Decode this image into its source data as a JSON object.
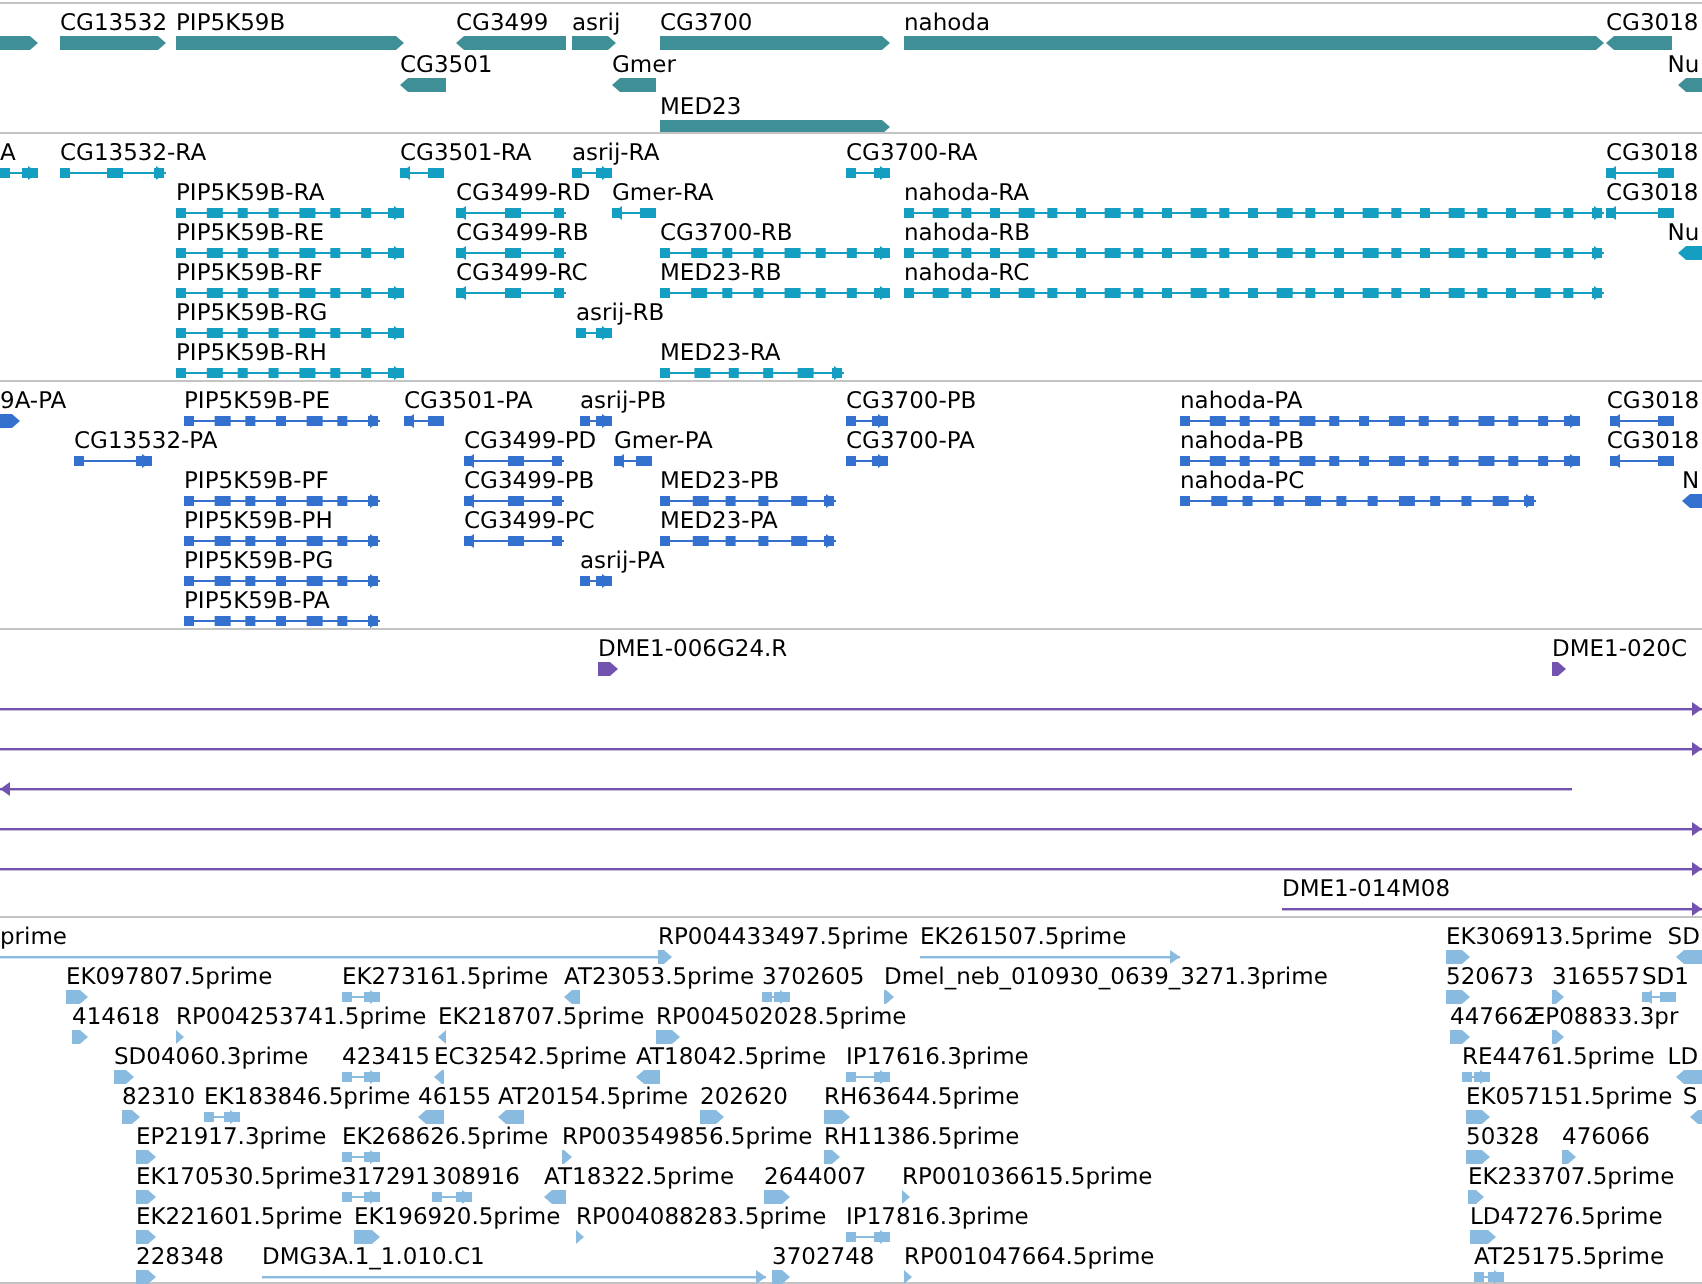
{
  "tracks": [
    {
      "color": "#3f9096",
      "features": [
        {
          "kind": "bar",
          "reverse": false
        },
        {
          "label": "CG13532",
          "kind": "bar",
          "reverse": false
        },
        {
          "label": "PIP5K59B",
          "kind": "bar",
          "reverse": false
        },
        {
          "label": "CG3499",
          "kind": "bar",
          "reverse": true
        },
        {
          "label": "asrij",
          "kind": "bar",
          "reverse": false
        },
        {
          "label": "CG3700",
          "kind": "bar",
          "reverse": false
        },
        {
          "label": "nahoda",
          "kind": "bar",
          "reverse": false
        },
        {
          "label": "CG3018",
          "kind": "bar",
          "reverse": true
        },
        {
          "label": "CG3501",
          "kind": "bar",
          "reverse": true
        },
        {
          "label": "Gmer",
          "kind": "bar",
          "reverse": true
        },
        {
          "label": "Nu",
          "kind": "bar",
          "reverse": true
        },
        {
          "label": "MED23",
          "kind": "bar",
          "reverse": false
        }
      ]
    },
    {
      "color": "#149fc2",
      "features": [
        {
          "label": "A",
          "kind": "exons",
          "reverse": false
        },
        {
          "label": "CG13532-RA",
          "kind": "exons",
          "reverse": false
        },
        {
          "label": "CG3501-RA",
          "kind": "exons",
          "reverse": true
        },
        {
          "label": "asrij-RA",
          "kind": "exons",
          "reverse": false
        },
        {
          "label": "CG3700-RA",
          "kind": "exons",
          "reverse": false
        },
        {
          "label": "CG3018",
          "kind": "exons",
          "reverse": true
        },
        {
          "label": "PIP5K59B-RA",
          "kind": "exons",
          "reverse": false
        },
        {
          "label": "CG3499-RD",
          "kind": "exons",
          "reverse": true
        },
        {
          "label": "Gmer-RA",
          "kind": "exons",
          "reverse": true
        },
        {
          "label": "nahoda-RA",
          "kind": "exons",
          "reverse": false
        },
        {
          "label": "CG3018",
          "kind": "exons",
          "reverse": true
        },
        {
          "label": "PIP5K59B-RE",
          "kind": "exons",
          "reverse": false
        },
        {
          "label": "CG3499-RB",
          "kind": "exons",
          "reverse": true
        },
        {
          "label": "CG3700-RB",
          "kind": "exons",
          "reverse": false
        },
        {
          "label": "nahoda-RB",
          "kind": "exons",
          "reverse": false
        },
        {
          "label": "Nu",
          "kind": "exons",
          "reverse": true
        },
        {
          "label": "PIP5K59B-RF",
          "kind": "exons",
          "reverse": false
        },
        {
          "label": "CG3499-RC",
          "kind": "exons",
          "reverse": true
        },
        {
          "label": "MED23-RB",
          "kind": "exons",
          "reverse": false
        },
        {
          "label": "nahoda-RC",
          "kind": "exons",
          "reverse": false
        },
        {
          "label": "PIP5K59B-RG",
          "kind": "exons",
          "reverse": false
        },
        {
          "label": "asrij-RB",
          "kind": "exons",
          "reverse": false
        },
        {
          "label": "PIP5K59B-RH",
          "kind": "exons",
          "reverse": false
        },
        {
          "label": "MED23-RA",
          "kind": "exons",
          "reverse": false
        }
      ]
    },
    {
      "color": "#3470cd",
      "features": [
        {
          "label": "9A-PA",
          "kind": "exons",
          "reverse": false
        },
        {
          "label": "PIP5K59B-PE",
          "kind": "exons",
          "reverse": false
        },
        {
          "label": "CG3501-PA",
          "kind": "exons",
          "reverse": true
        },
        {
          "label": "asrij-PB",
          "kind": "exons",
          "reverse": false
        },
        {
          "label": "CG3700-PB",
          "kind": "exons",
          "reverse": false
        },
        {
          "label": "nahoda-PA",
          "kind": "exons",
          "reverse": false
        },
        {
          "label": "CG3018",
          "kind": "exons",
          "reverse": true
        },
        {
          "label": "CG13532-PA",
          "kind": "exons",
          "reverse": false
        },
        {
          "label": "CG3499-PD",
          "kind": "exons",
          "reverse": true
        },
        {
          "label": "Gmer-PA",
          "kind": "exons",
          "reverse": true
        },
        {
          "label": "CG3700-PA",
          "kind": "exons",
          "reverse": false
        },
        {
          "label": "nahoda-PB",
          "kind": "exons",
          "reverse": false
        },
        {
          "label": "CG3018",
          "kind": "exons",
          "reverse": true
        },
        {
          "label": "PIP5K59B-PF",
          "kind": "exons",
          "reverse": false
        },
        {
          "label": "CG3499-PB",
          "kind": "exons",
          "reverse": true
        },
        {
          "label": "MED23-PB",
          "kind": "exons",
          "reverse": false
        },
        {
          "label": "nahoda-PC",
          "kind": "exons",
          "reverse": false
        },
        {
          "label": "N",
          "kind": "exons",
          "reverse": true
        },
        {
          "label": "PIP5K59B-PH",
          "kind": "exons",
          "reverse": false
        },
        {
          "label": "CG3499-PC",
          "kind": "exons",
          "reverse": true
        },
        {
          "label": "MED23-PA",
          "kind": "exons",
          "reverse": false
        },
        {
          "label": "PIP5K59B-PG",
          "kind": "exons",
          "reverse": false
        },
        {
          "label": "asrij-PA",
          "kind": "exons",
          "reverse": false
        },
        {
          "label": "PIP5K59B-PA",
          "kind": "exons",
          "reverse": false
        }
      ]
    },
    {
      "color": "#7353b0",
      "features": [
        {
          "label": "DME1-006G24.R",
          "kind": "bar",
          "reverse": false
        },
        {
          "label": "DME1-020C",
          "kind": "bar",
          "reverse": false
        },
        {
          "kind": "line",
          "reverse": false
        },
        {
          "kind": "line",
          "reverse": false
        },
        {
          "kind": "line",
          "reverse": true
        },
        {
          "kind": "line",
          "reverse": false
        },
        {
          "kind": "line",
          "reverse": false
        },
        {
          "label": "DME1-014M08",
          "kind": "line",
          "reverse": false
        }
      ]
    },
    {
      "color": "#88bbdf",
      "features": [
        {
          "label": "prime",
          "kind": "line",
          "reverse": false
        },
        {
          "label": "RP004433497.5prime",
          "kind": "exons",
          "reverse": false
        },
        {
          "label": "EK261507.5prime",
          "kind": "line",
          "reverse": false
        },
        {
          "label": "EK306913.5prime",
          "kind": "exons",
          "reverse": false
        },
        {
          "label": "SD",
          "kind": "exons",
          "reverse": true
        },
        {
          "label": "EK097807.5prime",
          "kind": "exons",
          "reverse": false
        },
        {
          "label": "EK273161.5prime",
          "kind": "exons",
          "reverse": false
        },
        {
          "label": "AT23053.5prime",
          "kind": "exons",
          "reverse": true
        },
        {
          "label": "3702605",
          "kind": "exons",
          "reverse": false
        },
        {
          "label": "Dmel_neb_010930_0639_3271.3prime",
          "kind": "exons",
          "reverse": false
        },
        {
          "label": "520673",
          "kind": "exons",
          "reverse": false
        },
        {
          "label": "316557",
          "kind": "exons",
          "reverse": false
        },
        {
          "label": "SD1",
          "kind": "exons",
          "reverse": true
        },
        {
          "label": "414618",
          "kind": "exons",
          "reverse": false
        },
        {
          "label": "RP004253741.5prime",
          "kind": "exons",
          "reverse": false
        },
        {
          "label": "EK218707.5prime",
          "kind": "exons",
          "reverse": true
        },
        {
          "label": "RP004502028.5prime",
          "kind": "exons",
          "reverse": false
        },
        {
          "label": "447662",
          "kind": "exons",
          "reverse": false
        },
        {
          "label": "EP08833.3pr",
          "kind": "exons",
          "reverse": false
        },
        {
          "label": "SD04060.3prime",
          "kind": "exons",
          "reverse": false
        },
        {
          "label": "423415",
          "kind": "exons",
          "reverse": false
        },
        {
          "label": "EC32542.5prime",
          "kind": "exons",
          "reverse": true
        },
        {
          "label": "AT18042.5prime",
          "kind": "exons",
          "reverse": true
        },
        {
          "label": "IP17616.3prime",
          "kind": "exons",
          "reverse": false
        },
        {
          "label": "RE44761.5prime",
          "kind": "exons",
          "reverse": false
        },
        {
          "label": "LD",
          "kind": "exons",
          "reverse": true
        },
        {
          "label": "82310",
          "kind": "exons",
          "reverse": false
        },
        {
          "label": "EK183846.5prime",
          "kind": "exons",
          "reverse": false
        },
        {
          "label": "46155",
          "kind": "exons",
          "reverse": true
        },
        {
          "label": "AT20154.5prime",
          "kind": "exons",
          "reverse": true
        },
        {
          "label": "202620",
          "kind": "exons",
          "reverse": false
        },
        {
          "label": "RH63644.5prime",
          "kind": "exons",
          "reverse": false
        },
        {
          "label": "EK057151.5prime",
          "kind": "exons",
          "reverse": false
        },
        {
          "label": "S",
          "kind": "exons",
          "reverse": true
        },
        {
          "label": "EP21917.3prime",
          "kind": "exons",
          "reverse": false
        },
        {
          "label": "EK268626.5prime",
          "kind": "exons",
          "reverse": false
        },
        {
          "label": "RP003549856.5prime",
          "kind": "exons",
          "reverse": false
        },
        {
          "label": "RH11386.5prime",
          "kind": "exons",
          "reverse": false
        },
        {
          "label": "50328",
          "kind": "exons",
          "reverse": false
        },
        {
          "label": "476066",
          "kind": "exons",
          "reverse": false
        },
        {
          "label": "EK170530.5prime",
          "kind": "exons",
          "reverse": false
        },
        {
          "label": "317291",
          "kind": "exons",
          "reverse": false
        },
        {
          "label": "308916",
          "kind": "exons",
          "reverse": false
        },
        {
          "label": "AT18322.5prime",
          "kind": "exons",
          "reverse": true
        },
        {
          "label": "2644007",
          "kind": "exons",
          "reverse": false
        },
        {
          "label": "RP001036615.5prime",
          "kind": "exons",
          "reverse": false
        },
        {
          "label": "EK233707.5prime",
          "kind": "exons",
          "reverse": false
        },
        {
          "label": "EK221601.5prime",
          "kind": "exons",
          "reverse": false
        },
        {
          "label": "EK196920.5prime",
          "kind": "exons",
          "reverse": false
        },
        {
          "label": "RP004088283.5prime",
          "kind": "exons",
          "reverse": false
        },
        {
          "label": "IP17816.3prime",
          "kind": "exons",
          "reverse": false
        },
        {
          "label": "LD47276.5prime",
          "kind": "exons",
          "reverse": false
        },
        {
          "label": "228348",
          "kind": "exons",
          "reverse": false
        },
        {
          "label": "DMG3A.1_1.010.C1",
          "kind": "line",
          "reverse": false
        },
        {
          "label": "3702748",
          "kind": "exons",
          "reverse": false
        },
        {
          "label": "RP001047664.5prime",
          "kind": "exons",
          "reverse": false
        },
        {
          "label": "AT25175.5prime",
          "kind": "exons",
          "reverse": false
        }
      ]
    }
  ]
}
